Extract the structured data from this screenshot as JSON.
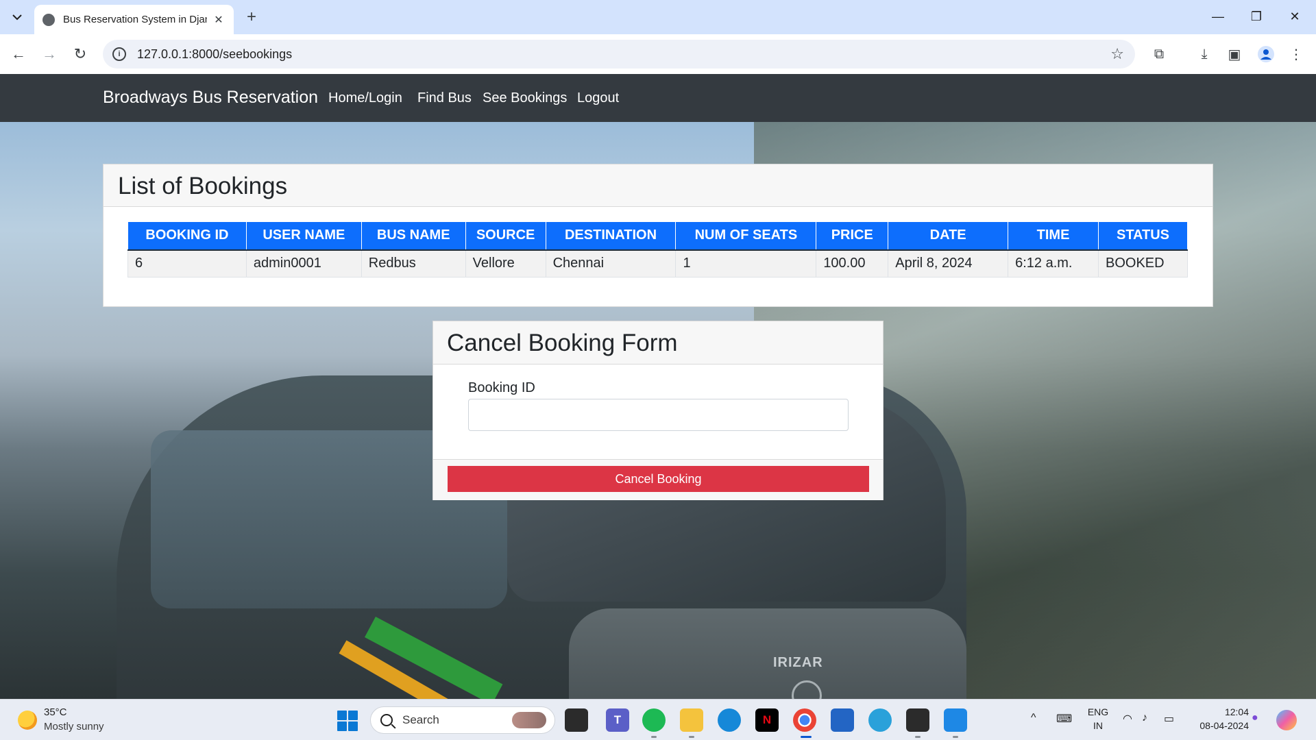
{
  "browser": {
    "tab_title": "Bus Reservation System in Djan",
    "url": "127.0.0.1:8000/seebookings"
  },
  "navbar": {
    "brand": "Broadways Bus Reservation",
    "links": [
      "Home/Login",
      "Find Bus",
      "See Bookings",
      "Logout"
    ]
  },
  "bookings": {
    "title": "List of Bookings",
    "columns": [
      "BOOKING ID",
      "USER NAME",
      "BUS NAME",
      "SOURCE",
      "DESTINATION",
      "NUM OF SEATS",
      "PRICE",
      "DATE",
      "TIME",
      "STATUS"
    ],
    "rows": [
      [
        "6",
        "admin0001",
        "Redbus",
        "Vellore",
        "Chennai",
        "1",
        "100.00",
        "April 8, 2024",
        "6:12 a.m.",
        "BOOKED"
      ]
    ],
    "header_color": "#0d6efd"
  },
  "cancel_form": {
    "title": "Cancel Booking Form",
    "field_label": "Booking ID",
    "field_value": "",
    "button_label": "Cancel Booking",
    "button_color": "#dc3545"
  },
  "background": {
    "bus_badge": "IRIZAR"
  },
  "taskbar": {
    "weather_temp": "35°C",
    "weather_desc": "Mostly sunny",
    "search_label": "Search",
    "lang_top": "ENG",
    "lang_bottom": "IN",
    "time": "12:04",
    "date": "08-04-2024"
  }
}
